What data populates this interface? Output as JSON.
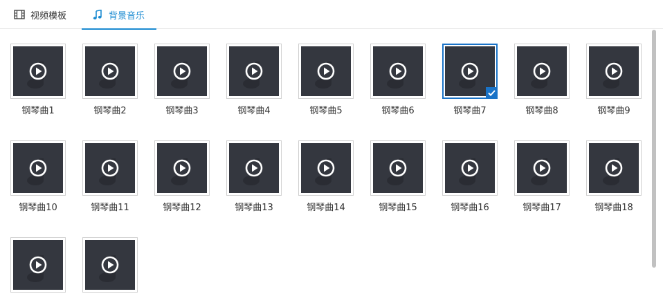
{
  "tabs": [
    {
      "label": "视频模板",
      "icon": "film-icon",
      "active": false
    },
    {
      "label": "背景音乐",
      "icon": "music-note-icon",
      "active": true
    }
  ],
  "tracks": [
    {
      "label": "钢琴曲1"
    },
    {
      "label": "钢琴曲2"
    },
    {
      "label": "钢琴曲3"
    },
    {
      "label": "钢琴曲4"
    },
    {
      "label": "钢琴曲5"
    },
    {
      "label": "钢琴曲6"
    },
    {
      "label": "钢琴曲7",
      "selected": true
    },
    {
      "label": "钢琴曲8"
    },
    {
      "label": "钢琴曲9"
    },
    {
      "label": "钢琴曲10"
    },
    {
      "label": "钢琴曲11"
    },
    {
      "label": "钢琴曲12"
    },
    {
      "label": "钢琴曲13"
    },
    {
      "label": "钢琴曲14"
    },
    {
      "label": "钢琴曲15"
    },
    {
      "label": "钢琴曲16"
    },
    {
      "label": "钢琴曲17"
    },
    {
      "label": "钢琴曲18"
    },
    {
      "label": ""
    },
    {
      "label": ""
    }
  ],
  "colors": {
    "accent": "#1a8ad1",
    "selected_border": "#1a73c7",
    "thumb_bg": "#34373f"
  }
}
